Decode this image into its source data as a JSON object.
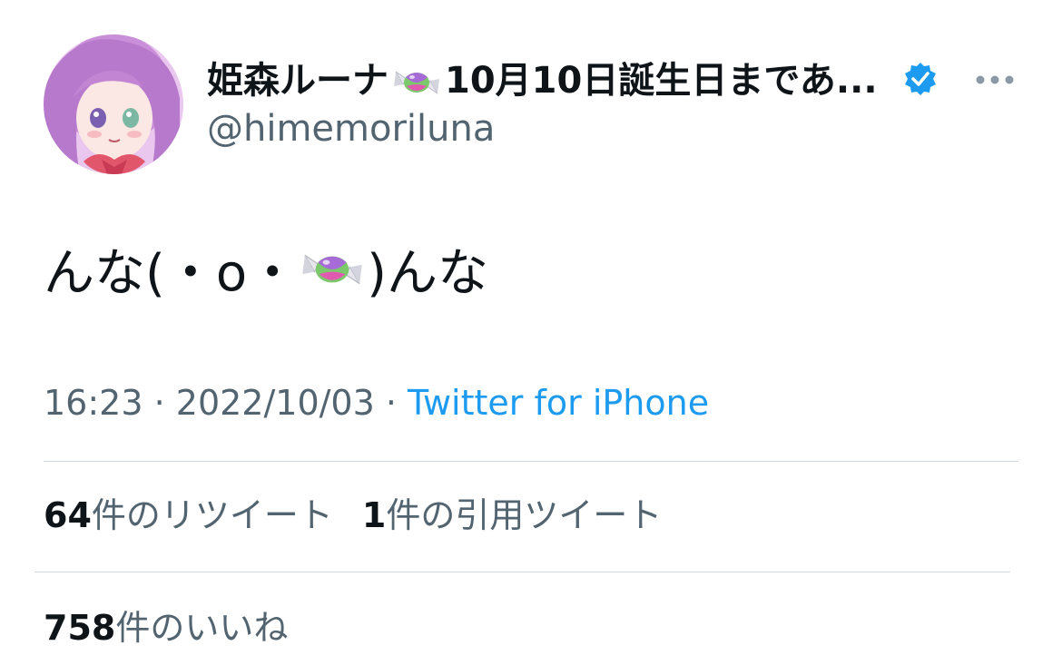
{
  "author": {
    "display_name_prefix": "姫森ルーナ",
    "display_name_suffix": "10月10日誕生日まであ...",
    "handle": "@himemoriluna",
    "verified": true,
    "avatar_icon": "avatar-illustration-pink-hair"
  },
  "tweet": {
    "text_before": "んな(・o・",
    "text_after": ")んな",
    "emoji": "candy-emoji"
  },
  "meta": {
    "time": "16:23",
    "separator": " · ",
    "date": "2022/10/03",
    "source": "Twitter for iPhone"
  },
  "stats": {
    "retweets_count": "64",
    "retweets_label": "件のリツイート",
    "quotes_count": "1",
    "quotes_label": "件の引用ツイート",
    "likes_count": "758",
    "likes_label": "件のいいね"
  },
  "colors": {
    "text": "#0f1419",
    "secondary": "#536471",
    "link": "#1d9bf0",
    "divider": "#cfd9de",
    "verified_badge": "#1d9bf0"
  }
}
